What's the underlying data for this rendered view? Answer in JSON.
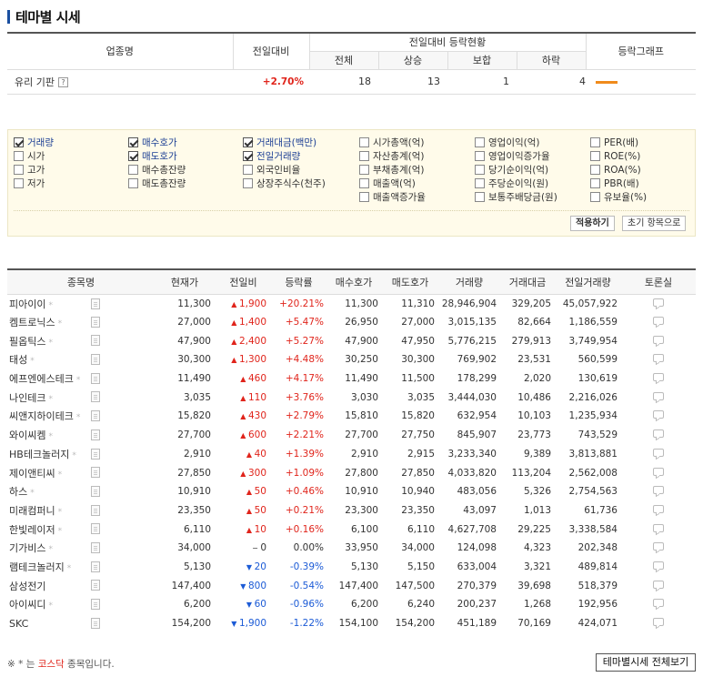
{
  "page_title": "테마별 시세",
  "summary": {
    "headers": {
      "industry": "업종명",
      "change_prev": "전일대비",
      "status_group": "전일대비 등락현황",
      "total": "전체",
      "rise": "상승",
      "flat": "보합",
      "fall": "하락",
      "graph": "등락그래프"
    },
    "help_glyph": "?",
    "row": {
      "name": "유리 기판",
      "change": "+2.70%",
      "total": "18",
      "rise": "13",
      "flat": "1",
      "fall": "4"
    }
  },
  "options": [
    {
      "label": "거래량",
      "checked": true
    },
    {
      "label": "시가",
      "checked": false
    },
    {
      "label": "고가",
      "checked": false
    },
    {
      "label": "저가",
      "checked": false
    },
    {
      "label": "매수호가",
      "checked": true
    },
    {
      "label": "매도호가",
      "checked": true
    },
    {
      "label": "매수총잔량",
      "checked": false
    },
    {
      "label": "매도총잔량",
      "checked": false
    },
    {
      "label": "거래대금(백만)",
      "checked": true
    },
    {
      "label": "전일거래량",
      "checked": true
    },
    {
      "label": "외국인비율",
      "checked": false
    },
    {
      "label": "상장주식수(천주)",
      "checked": false
    },
    {
      "label": "시가총액(억)",
      "checked": false
    },
    {
      "label": "자산총계(억)",
      "checked": false
    },
    {
      "label": "부채총계(억)",
      "checked": false
    },
    {
      "label": "매출액(억)",
      "checked": false
    },
    {
      "label": "매출액증가율",
      "checked": false
    },
    {
      "label": "영업이익(억)",
      "checked": false
    },
    {
      "label": "영업이익증가율",
      "checked": false
    },
    {
      "label": "당기순이익(억)",
      "checked": false
    },
    {
      "label": "주당순이익(원)",
      "checked": false
    },
    {
      "label": "보통주배당금(원)",
      "checked": false
    },
    {
      "label": "PER(배)",
      "checked": false
    },
    {
      "label": "ROE(%)",
      "checked": false
    },
    {
      "label": "ROA(%)",
      "checked": false
    },
    {
      "label": "PBR(배)",
      "checked": false
    },
    {
      "label": "유보율(%)",
      "checked": false
    }
  ],
  "buttons": {
    "apply": "적용하기",
    "reset": "초기 항목으로",
    "view_all": "테마별시세 전체보기"
  },
  "table": {
    "headers": [
      "종목명",
      "현재가",
      "전일비",
      "등락률",
      "매수호가",
      "매도호가",
      "거래량",
      "거래대금",
      "전일거래량",
      "토론실"
    ],
    "rows": [
      {
        "name": "피아이이",
        "kosdaq": true,
        "price": "11,300",
        "diff": "1,900",
        "dir": "up",
        "rate": "+20.21%",
        "bid": "11,300",
        "ask": "11,310",
        "vol": "28,946,904",
        "amt": "329,205",
        "pvol": "45,057,922"
      },
      {
        "name": "켐트로닉스",
        "kosdaq": true,
        "price": "27,000",
        "diff": "1,400",
        "dir": "up",
        "rate": "+5.47%",
        "bid": "26,950",
        "ask": "27,000",
        "vol": "3,015,135",
        "amt": "82,664",
        "pvol": "1,186,559"
      },
      {
        "name": "필옵틱스",
        "kosdaq": true,
        "price": "47,900",
        "diff": "2,400",
        "dir": "up",
        "rate": "+5.27%",
        "bid": "47,900",
        "ask": "47,950",
        "vol": "5,776,215",
        "amt": "279,913",
        "pvol": "3,749,954"
      },
      {
        "name": "태성",
        "kosdaq": true,
        "price": "30,300",
        "diff": "1,300",
        "dir": "up",
        "rate": "+4.48%",
        "bid": "30,250",
        "ask": "30,300",
        "vol": "769,902",
        "amt": "23,531",
        "pvol": "560,599"
      },
      {
        "name": "에프엔에스테크",
        "kosdaq": true,
        "price": "11,490",
        "diff": "460",
        "dir": "up",
        "rate": "+4.17%",
        "bid": "11,490",
        "ask": "11,500",
        "vol": "178,299",
        "amt": "2,020",
        "pvol": "130,619"
      },
      {
        "name": "나인테크",
        "kosdaq": true,
        "price": "3,035",
        "diff": "110",
        "dir": "up",
        "rate": "+3.76%",
        "bid": "3,030",
        "ask": "3,035",
        "vol": "3,444,030",
        "amt": "10,486",
        "pvol": "2,216,026"
      },
      {
        "name": "씨앤지하이테크",
        "kosdaq": true,
        "price": "15,820",
        "diff": "430",
        "dir": "up",
        "rate": "+2.79%",
        "bid": "15,810",
        "ask": "15,820",
        "vol": "632,954",
        "amt": "10,103",
        "pvol": "1,235,934"
      },
      {
        "name": "와이씨켐",
        "kosdaq": true,
        "price": "27,700",
        "diff": "600",
        "dir": "up",
        "rate": "+2.21%",
        "bid": "27,700",
        "ask": "27,750",
        "vol": "845,907",
        "amt": "23,773",
        "pvol": "743,529"
      },
      {
        "name": "HB테크놀러지",
        "kosdaq": true,
        "price": "2,910",
        "diff": "40",
        "dir": "up",
        "rate": "+1.39%",
        "bid": "2,910",
        "ask": "2,915",
        "vol": "3,233,340",
        "amt": "9,389",
        "pvol": "3,813,881"
      },
      {
        "name": "제이앤티씨",
        "kosdaq": true,
        "price": "27,850",
        "diff": "300",
        "dir": "up",
        "rate": "+1.09%",
        "bid": "27,800",
        "ask": "27,850",
        "vol": "4,033,820",
        "amt": "113,204",
        "pvol": "2,562,008"
      },
      {
        "name": "하스",
        "kosdaq": true,
        "price": "10,910",
        "diff": "50",
        "dir": "up",
        "rate": "+0.46%",
        "bid": "10,910",
        "ask": "10,940",
        "vol": "483,056",
        "amt": "5,326",
        "pvol": "2,754,563"
      },
      {
        "name": "미래컴퍼니",
        "kosdaq": true,
        "price": "23,350",
        "diff": "50",
        "dir": "up",
        "rate": "+0.21%",
        "bid": "23,300",
        "ask": "23,350",
        "vol": "43,097",
        "amt": "1,013",
        "pvol": "61,736"
      },
      {
        "name": "한빛레이저",
        "kosdaq": true,
        "price": "6,110",
        "diff": "10",
        "dir": "up",
        "rate": "+0.16%",
        "bid": "6,100",
        "ask": "6,110",
        "vol": "4,627,708",
        "amt": "29,225",
        "pvol": "3,338,584"
      },
      {
        "name": "기가비스",
        "kosdaq": true,
        "price": "34,000",
        "diff": "0",
        "dir": "flat",
        "rate": "0.00%",
        "bid": "33,950",
        "ask": "34,000",
        "vol": "124,098",
        "amt": "4,323",
        "pvol": "202,348"
      },
      {
        "name": "램테크놀러지",
        "kosdaq": true,
        "price": "5,130",
        "diff": "20",
        "dir": "down",
        "rate": "-0.39%",
        "bid": "5,130",
        "ask": "5,150",
        "vol": "633,004",
        "amt": "3,321",
        "pvol": "489,814"
      },
      {
        "name": "삼성전기",
        "kosdaq": false,
        "price": "147,400",
        "diff": "800",
        "dir": "down",
        "rate": "-0.54%",
        "bid": "147,400",
        "ask": "147,500",
        "vol": "270,379",
        "amt": "39,698",
        "pvol": "518,379"
      },
      {
        "name": "아이씨디",
        "kosdaq": true,
        "price": "6,200",
        "diff": "60",
        "dir": "down",
        "rate": "-0.96%",
        "bid": "6,200",
        "ask": "6,240",
        "vol": "200,237",
        "amt": "1,268",
        "pvol": "192,956"
      },
      {
        "name": "SKC",
        "kosdaq": false,
        "price": "154,200",
        "diff": "1,900",
        "dir": "down",
        "rate": "-1.22%",
        "bid": "154,100",
        "ask": "154,200",
        "vol": "451,189",
        "amt": "70,169",
        "pvol": "424,071"
      }
    ]
  },
  "note": {
    "prefix": "※ * 는 ",
    "kosdaq": "코스닥",
    "suffix": " 종목입니다."
  },
  "colors": {
    "up": "#e0241b",
    "down": "#1c5bd6",
    "accent": "#1a4fa0"
  }
}
